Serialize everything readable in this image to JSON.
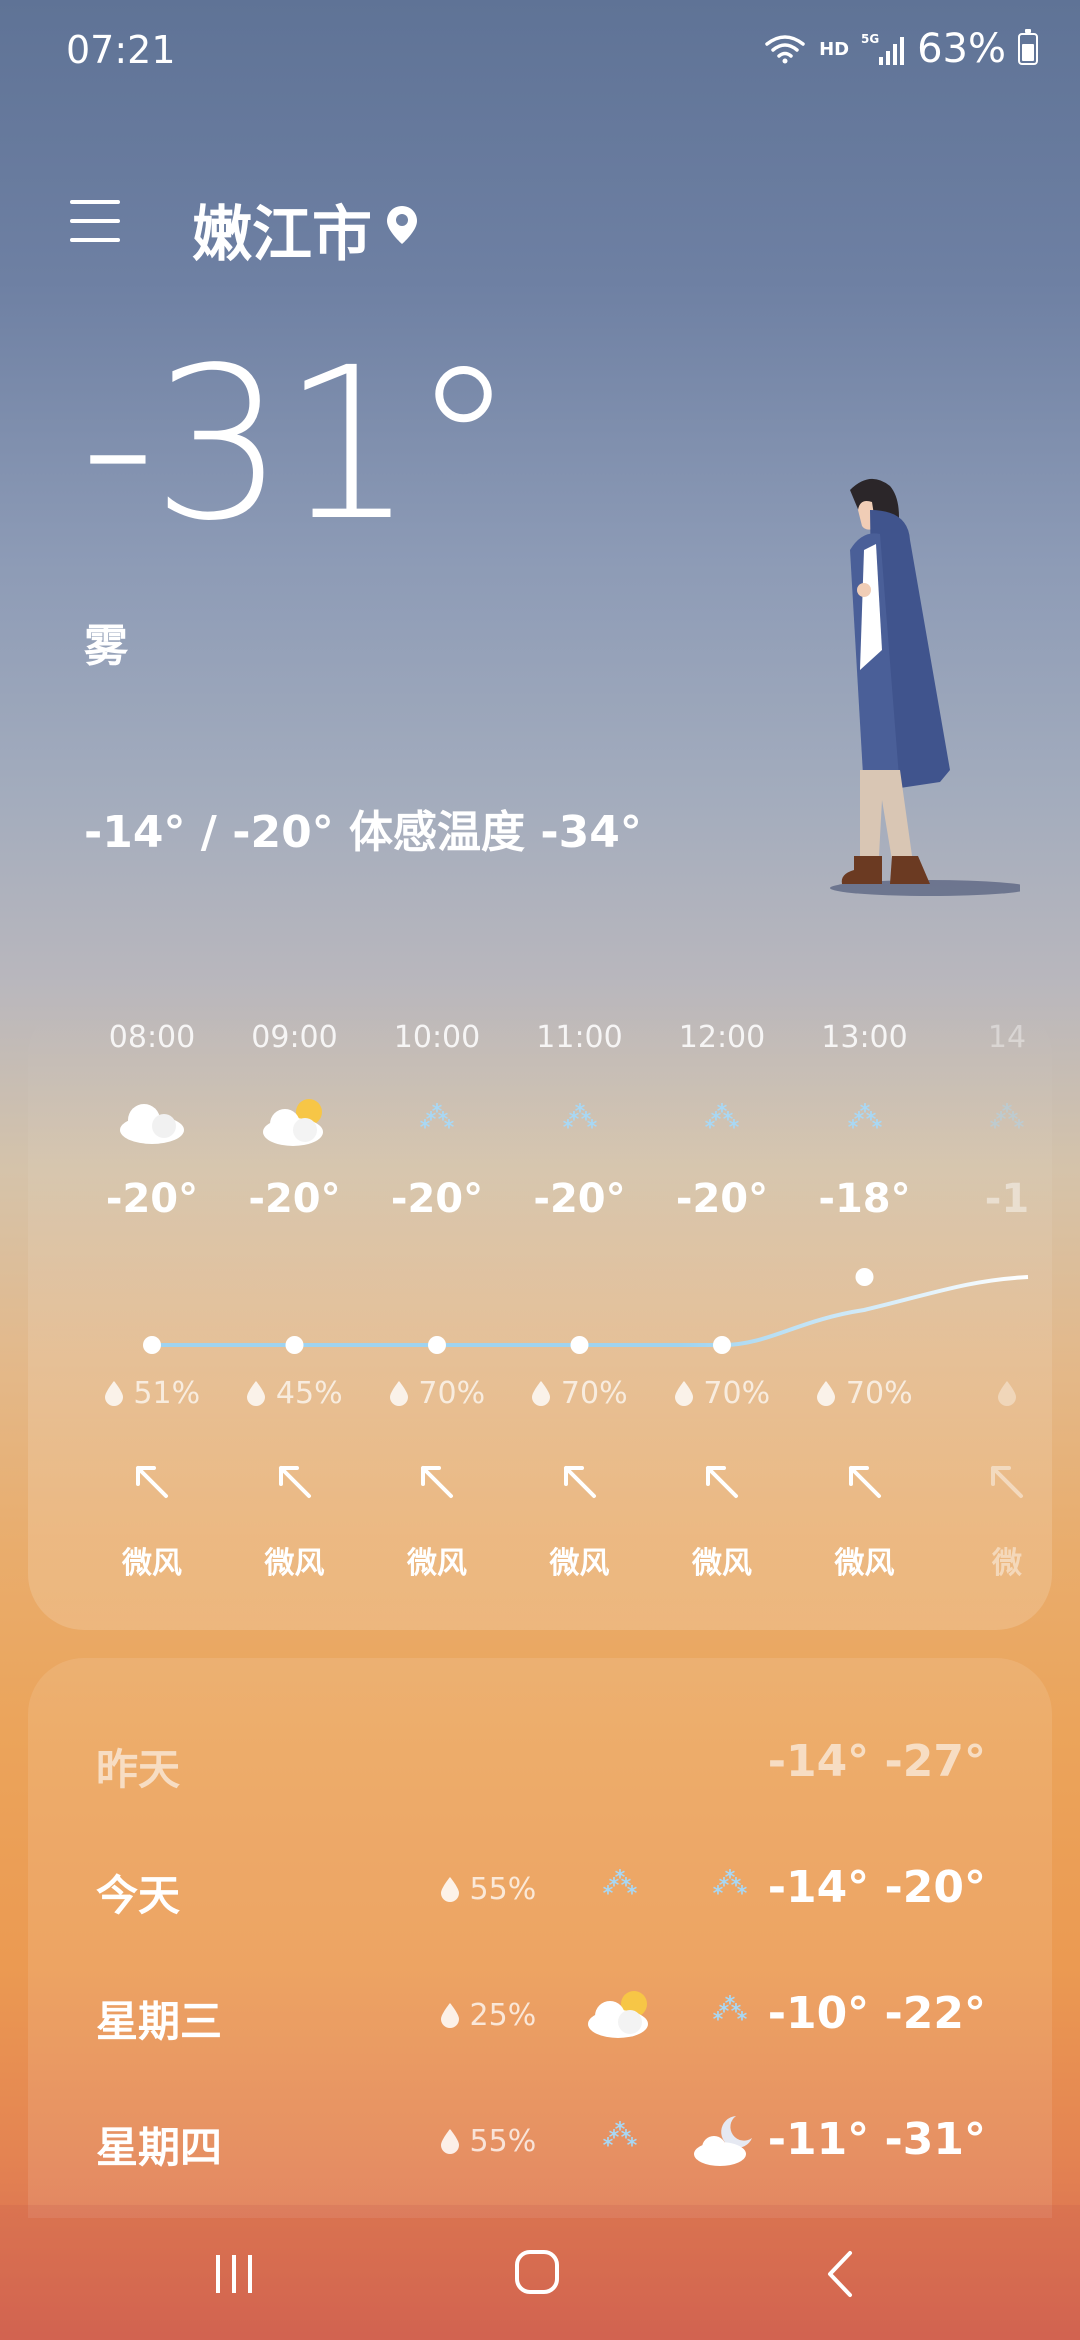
{
  "status_bar": {
    "time": "07:21",
    "hd": "HD",
    "net": "5G",
    "battery": "63%"
  },
  "header": {
    "city": "嫩江市"
  },
  "current": {
    "temp": "-31°",
    "condition": "雾",
    "range_feels": "-14° / -20° 体感温度 -34°"
  },
  "hourly": [
    {
      "time": "08:00",
      "icon": "cloudy-icon",
      "temp": "-20°",
      "humidity": "51%",
      "wind": "微风"
    },
    {
      "time": "09:00",
      "icon": "partly-sunny-icon",
      "temp": "-20°",
      "humidity": "45%",
      "wind": "微风"
    },
    {
      "time": "10:00",
      "icon": "snow-icon",
      "temp": "-20°",
      "humidity": "70%",
      "wind": "微风"
    },
    {
      "time": "11:00",
      "icon": "snow-icon",
      "temp": "-20°",
      "humidity": "70%",
      "wind": "微风"
    },
    {
      "time": "12:00",
      "icon": "snow-icon",
      "temp": "-20°",
      "humidity": "70%",
      "wind": "微风"
    },
    {
      "time": "13:00",
      "icon": "snow-icon",
      "temp": "-18°",
      "humidity": "70%",
      "wind": "微风"
    },
    {
      "time": "14",
      "icon": "snow-icon",
      "temp": "-1",
      "humidity": "",
      "wind": "微"
    }
  ],
  "hourly_temps_numeric": [
    -20,
    -20,
    -20,
    -20,
    -20,
    -18,
    -17
  ],
  "daily": [
    {
      "day": "昨天",
      "humidity": "",
      "icon_day": "",
      "icon_night": "",
      "temps": "-14° -27°"
    },
    {
      "day": "今天",
      "humidity": "55%",
      "icon_day": "snow-icon",
      "icon_night": "snow-icon",
      "temps": "-14° -20°"
    },
    {
      "day": "星期三",
      "humidity": "25%",
      "icon_day": "partly-sunny-icon",
      "icon_night": "snow-icon",
      "temps": "-10° -22°"
    },
    {
      "day": "星期四",
      "humidity": "55%",
      "icon_day": "snow-icon",
      "icon_night": "moon-cloud-icon",
      "temps": "-11° -31°"
    }
  ],
  "colors": {
    "line": "#9fd3f0",
    "snow": "#a8d8f5",
    "sun": "#f7c646"
  }
}
